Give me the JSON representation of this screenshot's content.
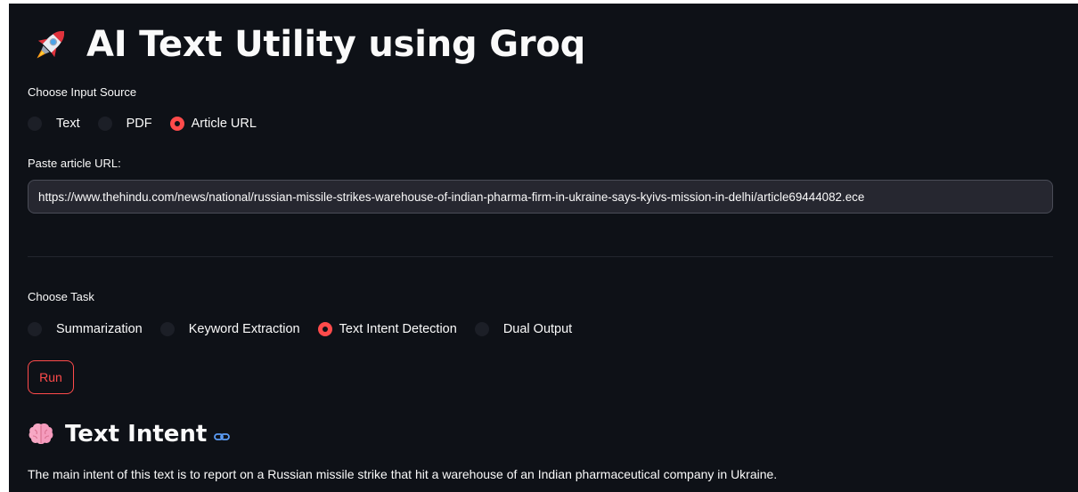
{
  "header": {
    "title": "AI Text Utility using Groq",
    "icon": "rocket-icon"
  },
  "input_source": {
    "label": "Choose Input Source",
    "options": [
      "Text",
      "PDF",
      "Article URL"
    ],
    "selected": "Article URL"
  },
  "url_field": {
    "label": "Paste article URL:",
    "value": "https://www.thehindu.com/news/national/russian-missile-strikes-warehouse-of-indian-pharma-firm-in-ukraine-says-kyivs-mission-in-delhi/article69444082.ece"
  },
  "task": {
    "label": "Choose Task",
    "options": [
      "Summarization",
      "Keyword Extraction",
      "Text Intent Detection",
      "Dual Output"
    ],
    "selected": "Text Intent Detection"
  },
  "run_button": {
    "label": "Run"
  },
  "result": {
    "title": "Text Intent",
    "icon": "brain-icon",
    "text": "The main intent of this text is to report on a Russian missile strike that hit a warehouse of an Indian pharmaceutical company in Ukraine."
  },
  "colors": {
    "background": "#0e1117",
    "accent": "#ff4b4b",
    "input_bg": "#262730",
    "link_icon": "#5b9cf5"
  }
}
